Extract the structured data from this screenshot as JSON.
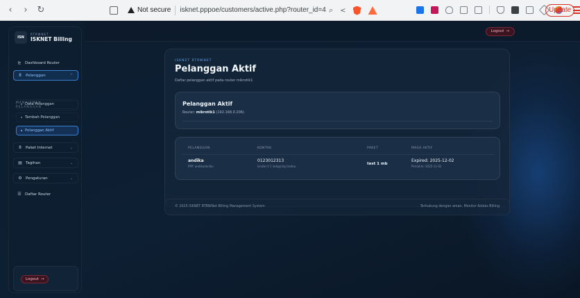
{
  "browser": {
    "security_label": "Not secure",
    "url": "isknet.pppoe/customers/active.php?router_id=4",
    "update_label": "Update"
  },
  "topbar": {
    "logout_label": "Logout",
    "logout_icon": "→"
  },
  "sidebar": {
    "brand_sub": "RTRWNET",
    "brand_name": "ISKNET Billing",
    "logo_text": "ISN",
    "items": [
      {
        "label": "Dashboard Router",
        "icon": "chart-icon"
      },
      {
        "label": "Pelanggan",
        "icon": "user-icon"
      },
      {
        "label": "Paket Internet",
        "icon": "box-icon"
      },
      {
        "label": "Tagihan",
        "icon": "receipt-icon"
      },
      {
        "label": "Pengaturan",
        "icon": "gear-icon"
      },
      {
        "label": "Daftar Router",
        "icon": "list-icon"
      }
    ],
    "group_label_1": "MANAJEMEN",
    "group_label_2": "PELANGGAN",
    "sub_items": [
      {
        "label": "Data Pelanggan"
      },
      {
        "label": "Tambah Pelanggan"
      },
      {
        "label": "Pelanggan Aktif"
      }
    ],
    "logout_label": "Logout",
    "logout_icon": "→"
  },
  "main": {
    "eyebrow": "ISKNET RTRWNET",
    "title": "Pelanggan Aktif",
    "description": "Daftar pelanggan aktif pada router mikrotik1",
    "router_card": {
      "title": "Pelanggan Aktif",
      "router_prefix": "Router:",
      "router_name": "mikrotik1",
      "router_ip": "(192.168.0.206)"
    },
    "table": {
      "headers": [
        "PELANGGAN",
        "KONTAK",
        "PAKET",
        "MASA AKTIF"
      ],
      "rows": [
        {
          "name": "andika",
          "ppp": "PPP: andikaduniku",
          "phone": "0123012313",
          "contact_sub": "kindie rt 1 indogrilrg tradea",
          "package": "test 1 mb",
          "expired": "Expired: 2025-12-02",
          "period": "Periodim: 2025-11-02"
        }
      ]
    }
  },
  "footer": {
    "left": "© 2025 ISKNET RTRWNet Billing Management System",
    "right": "Terhubung dengan aman. Monitor Koleks Billing"
  }
}
